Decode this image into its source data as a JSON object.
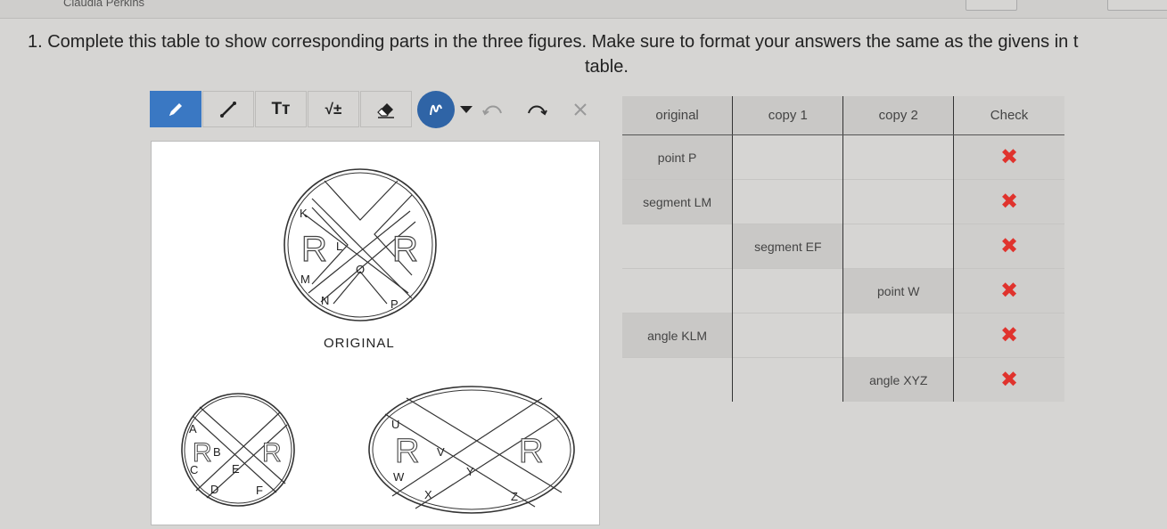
{
  "header": {
    "student_name": "Claudia Perkins"
  },
  "question": {
    "line1": "1. Complete this table to show corresponding parts in the three figures. Make sure to format your answers the same as the givens in t",
    "line2": "table."
  },
  "toolbar": {
    "pencil": "pencil-icon",
    "line": "line-icon",
    "text": "Tт",
    "math": "√±",
    "eraser": "eraser-icon"
  },
  "figure": {
    "original_caption": "ORIGINAL",
    "original_labels": [
      "K",
      "L",
      "M",
      "N",
      "O",
      "P",
      "R",
      "R"
    ],
    "copy1_labels": [
      "A",
      "B",
      "C",
      "D",
      "E",
      "F",
      "R",
      "R"
    ],
    "copy2_labels": [
      "U",
      "V",
      "W",
      "X",
      "Y",
      "Z",
      "R",
      "R"
    ]
  },
  "table": {
    "headers": [
      "original",
      "copy 1",
      "copy 2",
      "Check"
    ],
    "rows": [
      [
        "point P",
        "",
        "",
        ""
      ],
      [
        "segment LM",
        "",
        "",
        ""
      ],
      [
        "",
        "segment EF",
        "",
        ""
      ],
      [
        "",
        "",
        "point W",
        ""
      ],
      [
        "angle KLM",
        "",
        "",
        ""
      ],
      [
        "",
        "",
        "angle XYZ",
        ""
      ]
    ],
    "check_symbol": "✖",
    "check_color": "#e0332d"
  },
  "colors": {
    "accent": "#3a78c3",
    "accent_dark": "#2f64a6",
    "error": "#e0332d"
  }
}
